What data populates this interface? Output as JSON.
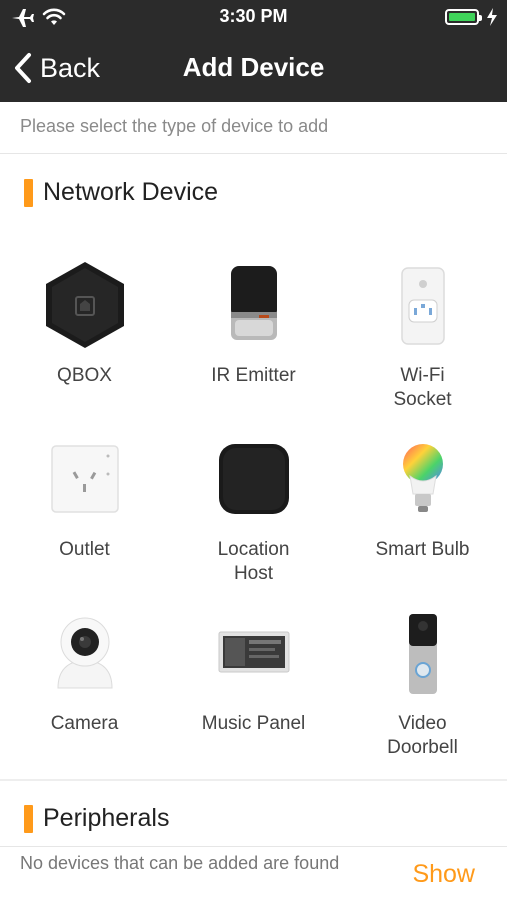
{
  "status_bar": {
    "time": "3:30 PM",
    "battery_color": "#3fd35a"
  },
  "nav": {
    "back_label": "Back",
    "title": "Add Device"
  },
  "instruction": "Please select the type of device to add",
  "sections": {
    "network": {
      "title": "Network Device"
    },
    "peripherals": {
      "title": "Peripherals",
      "empty_message": "No devices that can be added are found",
      "show_label": "Show"
    }
  },
  "devices": [
    {
      "name": "QBOX",
      "icon": "qbox-icon"
    },
    {
      "name": "IR Emitter",
      "icon": "ir-emitter-icon"
    },
    {
      "name": "Wi-Fi Socket",
      "icon": "wifi-socket-icon"
    },
    {
      "name": "Outlet",
      "icon": "outlet-icon"
    },
    {
      "name": "Location Host",
      "icon": "location-host-icon"
    },
    {
      "name": "Smart Bulb",
      "icon": "smart-bulb-icon"
    },
    {
      "name": "Camera",
      "icon": "camera-icon"
    },
    {
      "name": "Music Panel",
      "icon": "music-panel-icon"
    },
    {
      "name": "Video Doorbell",
      "icon": "video-doorbell-icon"
    }
  ],
  "accent_color": "#ff9a1a"
}
